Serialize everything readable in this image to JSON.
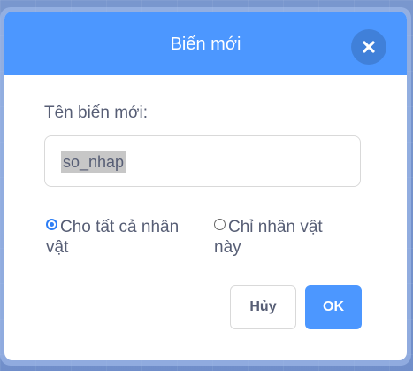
{
  "dialog": {
    "title": "Biến mới",
    "close_icon": "close-icon"
  },
  "form": {
    "name_label": "Tên biến mới:",
    "name_value": "so_nhap"
  },
  "scope": {
    "options": [
      {
        "label": "Cho tất cả nhân vật",
        "selected": true
      },
      {
        "label": "Chỉ nhân vật này",
        "selected": false
      }
    ]
  },
  "buttons": {
    "cancel_label": "Hủy",
    "ok_label": "OK"
  },
  "colors": {
    "accent": "#4c97ff",
    "text": "#575e75"
  }
}
